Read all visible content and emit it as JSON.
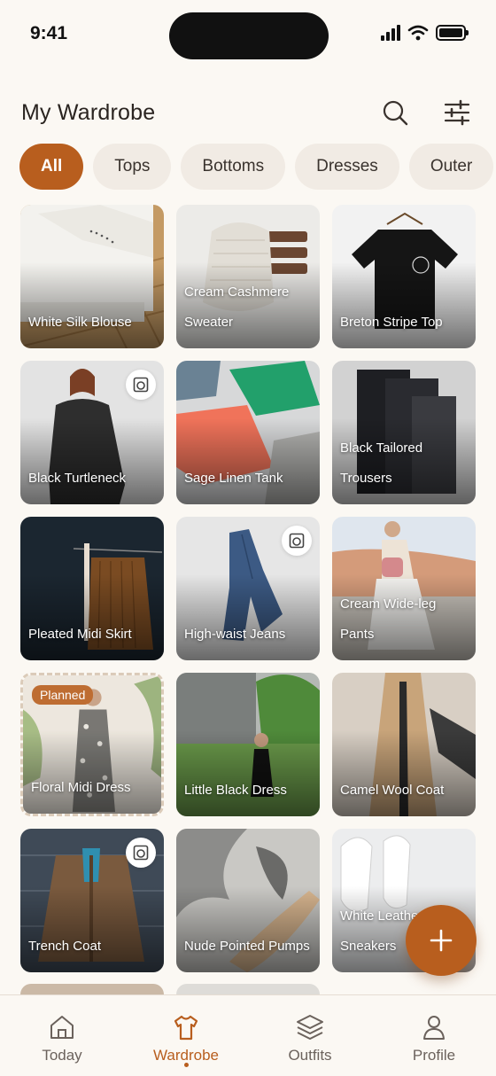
{
  "status": {
    "time": "9:41"
  },
  "header": {
    "title": "My Wardrobe",
    "search_icon": "search-icon",
    "filter_icon": "sliders-icon"
  },
  "chips": [
    "All",
    "Tops",
    "Bottoms",
    "Dresses",
    "Outer"
  ],
  "active_chip": "All",
  "items": [
    {
      "name": "White Silk Blouse",
      "planned": false,
      "laundry": false
    },
    {
      "name": "Cream Cashmere Sweater",
      "planned": false,
      "laundry": false
    },
    {
      "name": "Breton Stripe Top",
      "planned": false,
      "laundry": false
    },
    {
      "name": "Black Turtleneck",
      "planned": false,
      "laundry": true
    },
    {
      "name": "Sage Linen Tank",
      "planned": false,
      "laundry": false
    },
    {
      "name": "Black Tailored Trousers",
      "planned": false,
      "laundry": false
    },
    {
      "name": "Pleated Midi Skirt",
      "planned": false,
      "laundry": false
    },
    {
      "name": "High-waist Jeans",
      "planned": false,
      "laundry": true
    },
    {
      "name": "Cream Wide-leg Pants",
      "planned": false,
      "laundry": false
    },
    {
      "name": "Floral Midi Dress",
      "planned": true,
      "laundry": false
    },
    {
      "name": "Little Black Dress",
      "planned": false,
      "laundry": false
    },
    {
      "name": "Camel Wool Coat",
      "planned": false,
      "laundry": false
    },
    {
      "name": "Trench Coat",
      "planned": false,
      "laundry": true
    },
    {
      "name": "Nude Pointed Pumps",
      "planned": false,
      "laundry": false
    },
    {
      "name": "White Leather Sneakers",
      "planned": false,
      "laundry": false
    }
  ],
  "labels": {
    "planned": "Planned"
  },
  "tabs": [
    {
      "label": "Today",
      "icon": "home-icon"
    },
    {
      "label": "Wardrobe",
      "icon": "shirt-icon"
    },
    {
      "label": "Outfits",
      "icon": "layers-icon"
    },
    {
      "label": "Profile",
      "icon": "user-icon"
    }
  ],
  "active_tab": "Wardrobe",
  "colors": {
    "accent": "#b85e1e",
    "background": "#fbf8f3",
    "chip": "#f1ebe4"
  }
}
